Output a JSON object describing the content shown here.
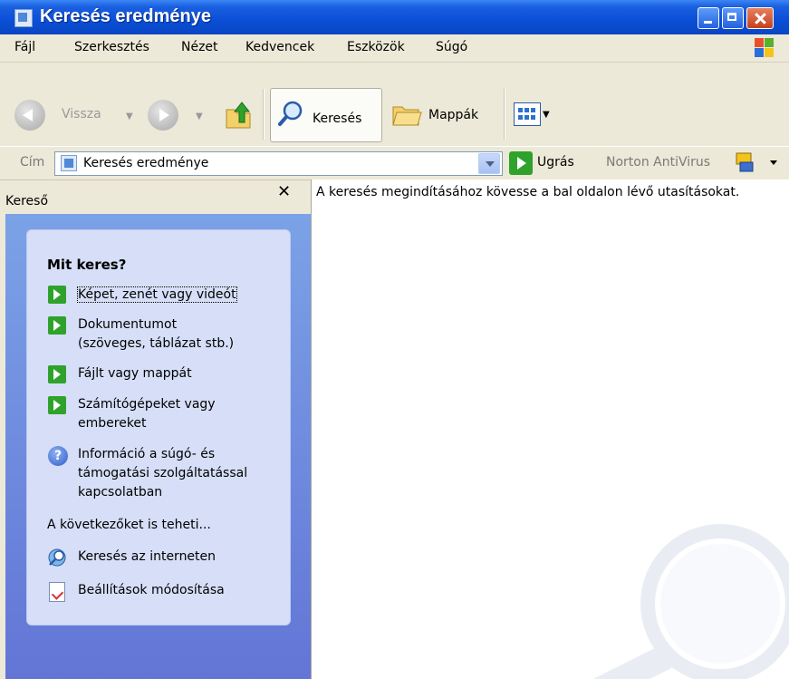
{
  "window": {
    "title": "Keresés eredménye"
  },
  "menu": [
    "Fájl",
    "Szerkesztés",
    "Nézet",
    "Kedvencek",
    "Eszközök",
    "Súgó"
  ],
  "toolbar": {
    "back": "Vissza",
    "search": "Keresés",
    "folders": "Mappák"
  },
  "address": {
    "label": "Cím",
    "value": "Keresés eredménye",
    "go": "Ugrás",
    "norton": "Norton AntiVirus"
  },
  "left_pane": {
    "title": "Kereső",
    "close": "✕",
    "question": "Mit keres?",
    "options": [
      "Képet, zenét vagy videót",
      "Dokumentumot",
      "(szöveges, táblázat stb.)",
      "Fájlt vagy mappát",
      "Számítógépeket vagy",
      "embereket",
      "Információ a súgó- és",
      "támogatási szolgáltatással",
      "kapcsolatban"
    ],
    "also_label": "A következőket is teheti...",
    "links": [
      "Keresés az interneten",
      "Beállítások módosítása"
    ]
  },
  "right_pane": {
    "hint": "A keresés megindításához kövesse a bal oldalon lévő utasításokat."
  },
  "colors": {
    "titlebar": "#0a4fd6",
    "pane_gradient_top": "#7ba2e7",
    "pane_gradient_bottom": "#6375d6",
    "card": "#d6dff7",
    "go_green": "#2fa22b"
  }
}
